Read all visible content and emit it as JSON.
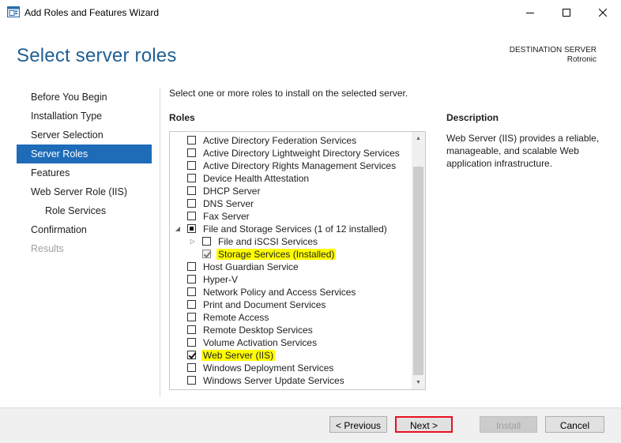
{
  "window": {
    "title": "Add Roles and Features Wizard",
    "controls": [
      "minimize-icon",
      "maximize-icon",
      "close-icon"
    ]
  },
  "header": {
    "page_title": "Select server roles",
    "destination_label": "DESTINATION SERVER",
    "destination_server": "Rotronic"
  },
  "nav": {
    "items": [
      {
        "label": "Before You Begin",
        "state": "normal"
      },
      {
        "label": "Installation Type",
        "state": "normal"
      },
      {
        "label": "Server Selection",
        "state": "normal"
      },
      {
        "label": "Server Roles",
        "state": "selected"
      },
      {
        "label": "Features",
        "state": "normal"
      },
      {
        "label": "Web Server Role (IIS)",
        "state": "normal"
      },
      {
        "label": "Role Services",
        "state": "sub"
      },
      {
        "label": "Confirmation",
        "state": "normal"
      },
      {
        "label": "Results",
        "state": "disabled"
      }
    ]
  },
  "main": {
    "instruction": "Select one or more roles to install on the selected server.",
    "roles_heading": "Roles",
    "description_heading": "Description",
    "description_text": "Web Server (IIS) provides a reliable, manageable, and scalable Web application infrastructure."
  },
  "roles": [
    {
      "label": "Active Directory Federation Services",
      "level": 0,
      "checked": "none",
      "expander": "",
      "highlight": false
    },
    {
      "label": "Active Directory Lightweight Directory Services",
      "level": 0,
      "checked": "none",
      "expander": "",
      "highlight": false
    },
    {
      "label": "Active Directory Rights Management Services",
      "level": 0,
      "checked": "none",
      "expander": "",
      "highlight": false
    },
    {
      "label": "Device Health Attestation",
      "level": 0,
      "checked": "none",
      "expander": "",
      "highlight": false
    },
    {
      "label": "DHCP Server",
      "level": 0,
      "checked": "none",
      "expander": "",
      "highlight": false
    },
    {
      "label": "DNS Server",
      "level": 0,
      "checked": "none",
      "expander": "",
      "highlight": false
    },
    {
      "label": "Fax Server",
      "level": 0,
      "checked": "none",
      "expander": "",
      "highlight": false
    },
    {
      "label": "File and Storage Services (1 of 12 installed)",
      "level": 0,
      "checked": "indeterminate",
      "expander": "expanded",
      "highlight": false
    },
    {
      "label": "File and iSCSI Services",
      "level": 1,
      "checked": "none",
      "expander": "collapsed",
      "highlight": false
    },
    {
      "label": "Storage Services (Installed)",
      "level": 1,
      "checked": "checked-disabled",
      "expander": "",
      "highlight": true
    },
    {
      "label": "Host Guardian Service",
      "level": 0,
      "checked": "none",
      "expander": "",
      "highlight": false
    },
    {
      "label": "Hyper-V",
      "level": 0,
      "checked": "none",
      "expander": "",
      "highlight": false
    },
    {
      "label": "Network Policy and Access Services",
      "level": 0,
      "checked": "none",
      "expander": "",
      "highlight": false
    },
    {
      "label": "Print and Document Services",
      "level": 0,
      "checked": "none",
      "expander": "",
      "highlight": false
    },
    {
      "label": "Remote Access",
      "level": 0,
      "checked": "none",
      "expander": "",
      "highlight": false
    },
    {
      "label": "Remote Desktop Services",
      "level": 0,
      "checked": "none",
      "expander": "",
      "highlight": false
    },
    {
      "label": "Volume Activation Services",
      "level": 0,
      "checked": "none",
      "expander": "",
      "highlight": false
    },
    {
      "label": "Web Server (IIS)",
      "level": 0,
      "checked": "checked",
      "expander": "",
      "highlight": true
    },
    {
      "label": "Windows Deployment Services",
      "level": 0,
      "checked": "none",
      "expander": "",
      "highlight": false
    },
    {
      "label": "Windows Server Update Services",
      "level": 0,
      "checked": "none",
      "expander": "",
      "highlight": false
    }
  ],
  "buttons": {
    "previous": "< Previous",
    "next": "Next >",
    "install": "Install",
    "cancel": "Cancel"
  },
  "colors": {
    "title_blue": "#1f5f95",
    "selected_nav": "#1e6bb8",
    "highlight": "#ffff00",
    "default_button_border": "#e81123"
  }
}
